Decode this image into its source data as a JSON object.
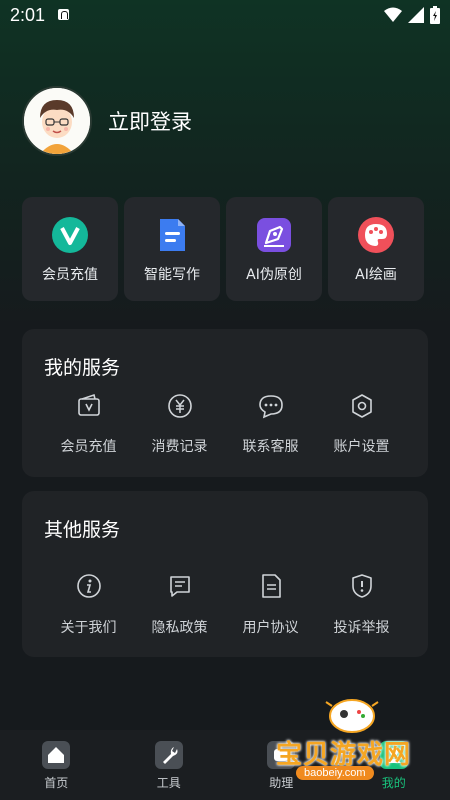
{
  "status_bar": {
    "time": "2:01"
  },
  "profile": {
    "login_label": "立即登录"
  },
  "quick_actions": [
    {
      "label": "会员充值",
      "icon": "vip-v-icon",
      "color": "#14b89a"
    },
    {
      "label": "智能写作",
      "icon": "document-icon",
      "color": "#3c7cf0"
    },
    {
      "label": "AI伪原创",
      "icon": "pen-icon",
      "color": "#7a4fe0"
    },
    {
      "label": "AI绘画",
      "icon": "palette-icon",
      "color": "#f0505a"
    }
  ],
  "my_services": {
    "title": "我的服务",
    "items": [
      {
        "label": "会员充值",
        "icon": "vip-wallet-icon"
      },
      {
        "label": "消费记录",
        "icon": "yen-icon"
      },
      {
        "label": "联系客服",
        "icon": "chat-icon"
      },
      {
        "label": "账户设置",
        "icon": "settings-icon"
      }
    ]
  },
  "other_services": {
    "title": "其他服务",
    "items": [
      {
        "label": "关于我们",
        "icon": "info-icon"
      },
      {
        "label": "隐私政策",
        "icon": "privacy-doc-icon"
      },
      {
        "label": "用户协议",
        "icon": "agreement-icon"
      },
      {
        "label": "投诉举报",
        "icon": "shield-alert-icon"
      }
    ]
  },
  "tab_bar": [
    {
      "label": "首页",
      "icon": "home-icon"
    },
    {
      "label": "工具",
      "icon": "wrench-icon"
    },
    {
      "label": "助理",
      "icon": "assistant-icon"
    },
    {
      "label": "我的",
      "icon": "profile-icon",
      "active": true
    }
  ],
  "watermark": {
    "text": "宝贝游戏网",
    "url": "baobeiy.com"
  },
  "colors": {
    "accent": "#19c37d",
    "card": "#25282c",
    "panel": "#202326"
  }
}
